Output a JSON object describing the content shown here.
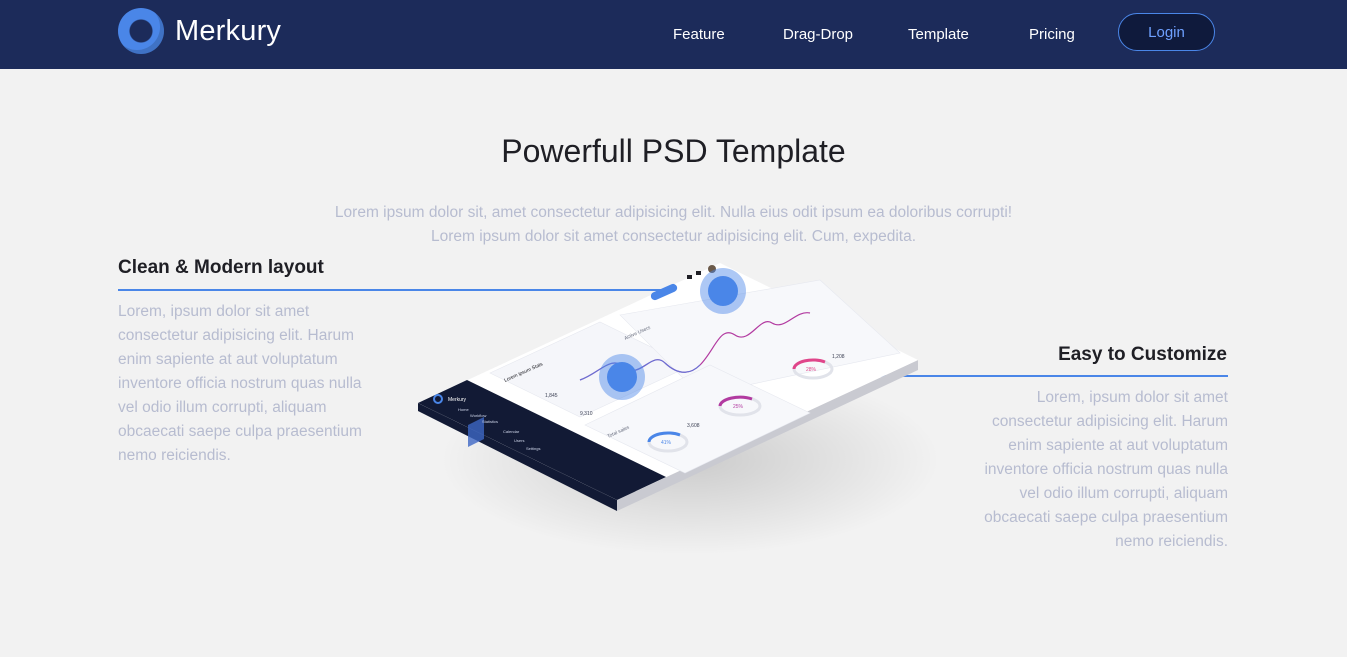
{
  "header": {
    "brand": "Merkury",
    "nav": [
      "Feature",
      "Drag-Drop",
      "Template",
      "Pricing"
    ],
    "login_label": "Login"
  },
  "hero": {
    "title": "Powerfull PSD Template",
    "subtitle_line1": "Lorem ipsum dolor sit, amet consectetur adipisicing elit. Nulla eius odit ipsum ea doloribus corrupti!",
    "subtitle_line2": "Lorem ipsum dolor sit amet consectetur adipisicing elit. Cum, expedita."
  },
  "features": [
    {
      "title": "Clean & Modern layout",
      "text": "Lorem, ipsum dolor sit amet consectetur adipisicing elit. Harum enim sapiente at aut voluptatum inventore officia nostrum quas nulla vel odio illum corrupti, aliquam obcaecati saepe culpa praesentium nemo reiciendis."
    },
    {
      "title": "Easy to Customize",
      "text": "Lorem, ipsum dolor sit amet consectetur adipisicing elit. Harum enim sapiente at aut voluptatum inventore officia nostrum quas nulla vel odio illum corrupti, aliquam obcaecati saepe culpa praesentium nemo reiciendis."
    }
  ],
  "mockup": {
    "sidebar_brand": "Merkury",
    "sidebar_items": [
      "Home",
      "Workflow",
      "Statistics",
      "Calendar",
      "Users",
      "Settings"
    ],
    "widget_title": "Lorem ipsum Stats",
    "chart_label": "Active Users",
    "sales_label": "Total sales",
    "stats": [
      "1,845",
      "9,310",
      "3,608",
      "1,208"
    ],
    "rings": [
      "41%",
      "25%",
      "28%"
    ]
  },
  "colors": {
    "header_bg": "#1c2b5a",
    "accent": "#4a86e8",
    "page_bg": "#f2f2f2",
    "muted_text": "#b7bcd0"
  }
}
